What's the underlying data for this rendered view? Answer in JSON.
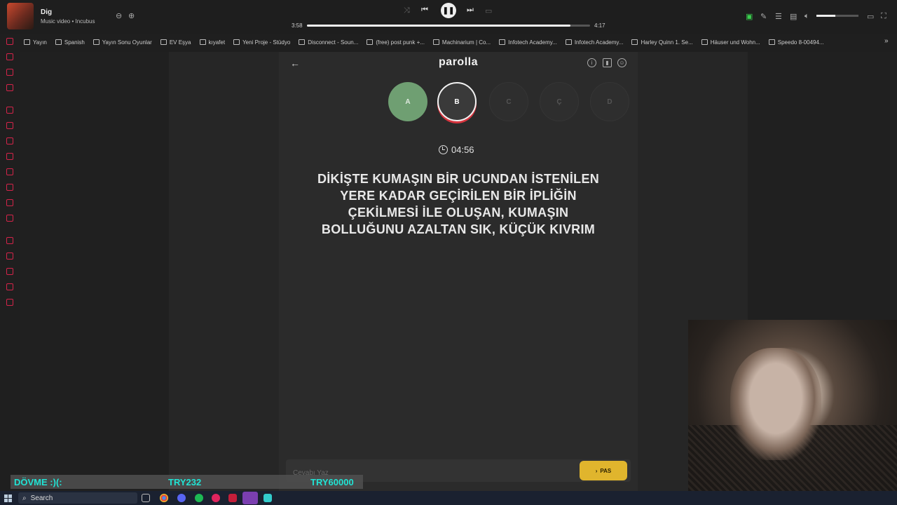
{
  "media": {
    "title": "Dig",
    "subtitle": "Music video • Incubus",
    "time_elapsed": "3:58",
    "time_total": "4:17",
    "progress": 0.93,
    "volume": 0.45,
    "play_state_icon": "pause-icon"
  },
  "bookmarks": [
    "Yayın",
    "Spanish",
    "Yayın Sonu Oyunlar",
    "EV Eşya",
    "kıyafet",
    "Yeni Proje - Stüdyo",
    "Disconnect - Soun...",
    "(free) post punk +...",
    "Machinarium | Co...",
    "Infotech Academy...",
    "Infotech Academy...",
    "Harley Quinn 1. Se...",
    "Häuser und Wohn...",
    "Speedo 8-00494..."
  ],
  "game": {
    "title": "parolla",
    "letters": [
      {
        "label": "A",
        "state": "done"
      },
      {
        "label": "B",
        "state": "current"
      },
      {
        "label": "C",
        "state": "pending"
      },
      {
        "label": "Ç",
        "state": "pending"
      },
      {
        "label": "D",
        "state": "pending"
      }
    ],
    "timer": "04:56",
    "question": "DİKİŞTE KUMAŞIN BİR UCUNDAN İSTENİLEN YERE KADAR GEÇİRİLEN BİR İPLİĞİN ÇEKİLMESİ İLE OLUŞAN, KUMAŞIN BOLLUĞUNU AZALTAN SIK, KÜÇÜK KIVRIM",
    "answer_placeholder": "Cevabı Yaz",
    "pass_label": "PAS",
    "colors": {
      "done": "#6f9f72",
      "current_ring": "#d6353f",
      "pass": "#e0b52d"
    }
  },
  "donation": {
    "name": "DÖVME :)(: ",
    "amount": "TRY232",
    "goal": "TRY60000"
  },
  "taskbar": {
    "search_label": "Search"
  }
}
